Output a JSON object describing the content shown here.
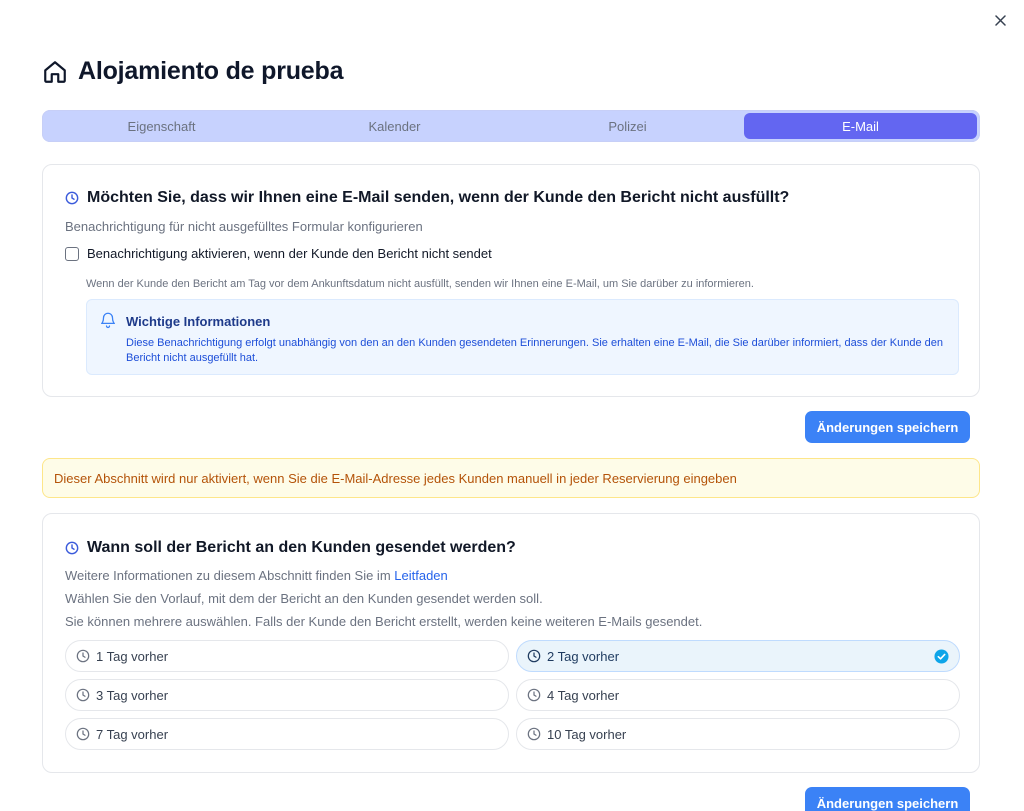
{
  "header": {
    "title": "Alojamiento de prueba"
  },
  "tabs": [
    {
      "label": "Eigenschaft",
      "active": false
    },
    {
      "label": "Kalender",
      "active": false
    },
    {
      "label": "Polizei",
      "active": false
    },
    {
      "label": "E-Mail",
      "active": true
    }
  ],
  "notification_card": {
    "title": "Möchten Sie, dass wir Ihnen eine E-Mail senden, wenn der Kunde den Bericht nicht ausfüllt?",
    "subtitle": "Benachrichtigung für nicht ausgefülltes Formular konfigurieren",
    "checkbox_label": "Benachrichtigung aktivieren, wenn der Kunde den Bericht nicht sendet",
    "checkbox_checked": false,
    "note": "Wenn der Kunde den Bericht am Tag vor dem Ankunftsdatum nicht ausfüllt, senden wir Ihnen eine E-Mail, um Sie darüber zu informieren.",
    "info_title": "Wichtige Informationen",
    "info_text": "Diese Benachrichtigung erfolgt unabhängig von den an den Kunden gesendeten Erinnerungen. Sie erhalten eine E-Mail, die Sie darüber informiert, dass der Kunde den Bericht nicht ausgefüllt hat.",
    "save_label": "Änderungen speichern"
  },
  "warning_text": "Dieser Abschnitt wird nur aktiviert, wenn Sie die E-Mail-Adresse jedes Kunden manuell in jeder Reservierung eingeben",
  "schedule_card": {
    "title": "Wann soll der Bericht an den Kunden gesendet werden?",
    "line1_prefix": "Weitere Informationen zu diesem Abschnitt finden Sie im ",
    "line1_link": "Leitfaden",
    "line2": "Wählen Sie den Vorlauf, mit dem der Bericht an den Kunden gesendet werden soll.",
    "line3": "Sie können mehrere auswählen. Falls der Kunde den Bericht erstellt, werden keine weiteren E-Mails gesendet.",
    "options": [
      {
        "label": "1 Tag vorher",
        "selected": false
      },
      {
        "label": "2 Tag vorher",
        "selected": true
      },
      {
        "label": "3 Tag vorher",
        "selected": false
      },
      {
        "label": "4 Tag vorher",
        "selected": false
      },
      {
        "label": "7 Tag vorher",
        "selected": false
      },
      {
        "label": "10 Tag vorher",
        "selected": false
      }
    ],
    "save_label": "Änderungen speichern"
  },
  "icons": {
    "close": "close-icon",
    "house": "house-icon",
    "clock": "clock-icon",
    "bell": "bell-icon",
    "check": "check-circle-icon"
  },
  "colors": {
    "accent": "#6366f1",
    "tab_bg": "#c7d2fe",
    "primary_button": "#3b82f6",
    "info_bg": "#eff6ff",
    "warning_bg": "#fefce8",
    "warning_text": "#b45309",
    "selected_option_bg": "#eaf4fb",
    "check_color": "#0ea5e9"
  }
}
